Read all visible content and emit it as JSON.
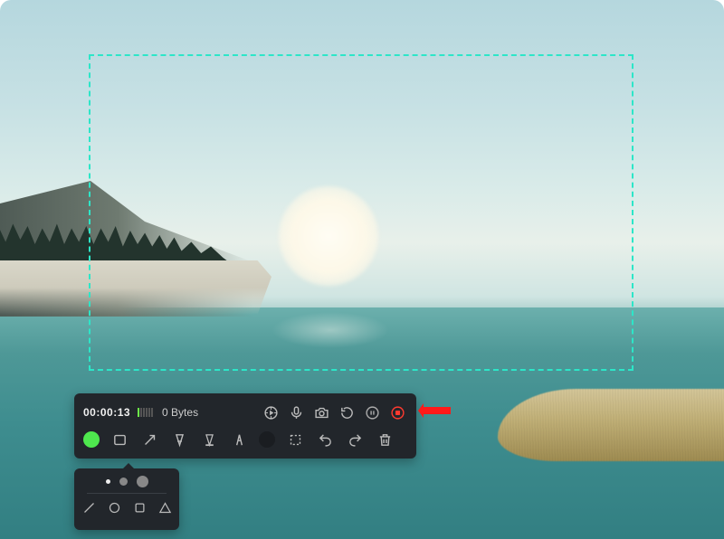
{
  "recording": {
    "timer": "00:00:13",
    "filesize": "0 Bytes"
  },
  "colors": {
    "accent_green": "#4ee84e",
    "stop_red": "#ff3a2f",
    "selection_border": "#2ce6c8"
  },
  "toolbar": {
    "top_icons": [
      "cursor",
      "microphone",
      "camera",
      "refresh",
      "pause",
      "stop"
    ],
    "bottom_tools": [
      "color",
      "rectangle",
      "arrow",
      "text",
      "highlighter",
      "caliper",
      "blur",
      "crop",
      "undo",
      "redo",
      "delete"
    ]
  },
  "sub_panel": {
    "sizes": [
      "small",
      "medium",
      "large"
    ],
    "shapes": [
      "line",
      "circle",
      "square",
      "triangle"
    ]
  }
}
